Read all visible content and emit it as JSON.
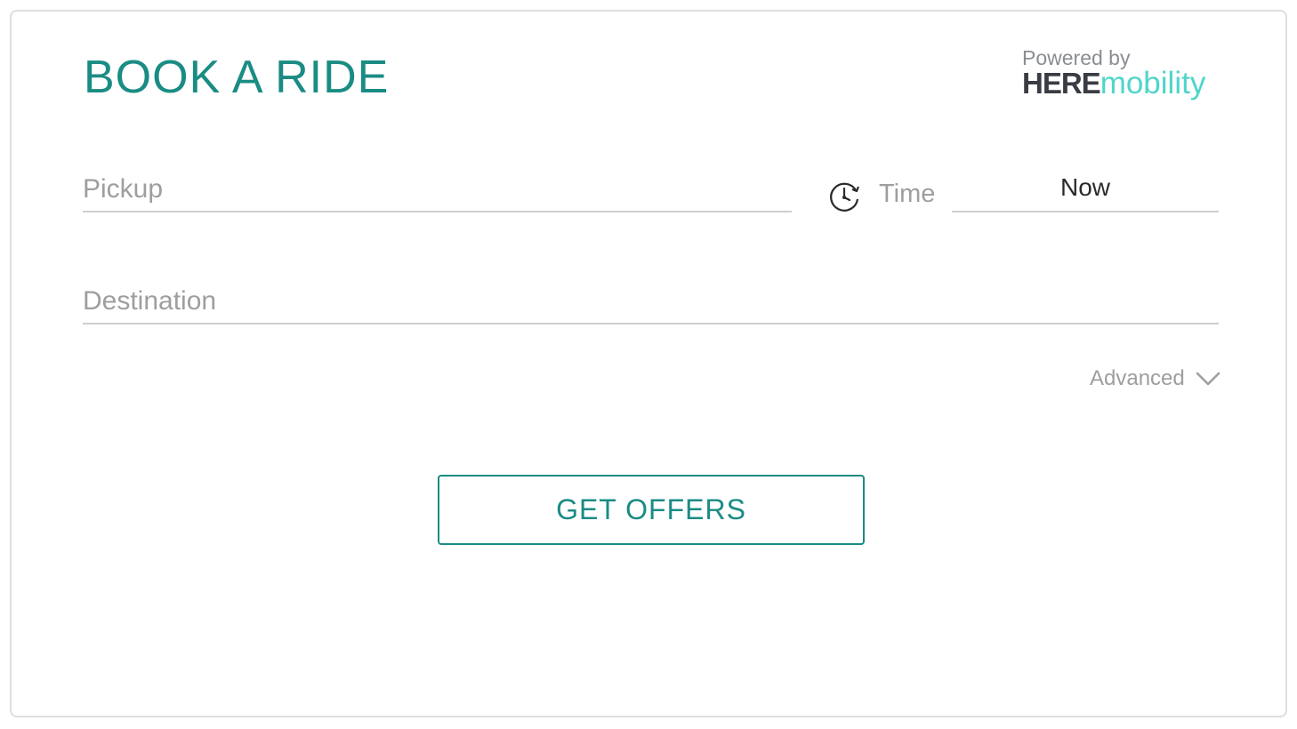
{
  "header": {
    "title": "BOOK A RIDE",
    "brand": {
      "powered_by": "Powered by",
      "logo_here": "HERE",
      "logo_mobility": "mobility"
    }
  },
  "form": {
    "pickup": {
      "placeholder": "Pickup",
      "value": ""
    },
    "time": {
      "icon": "clock-icon",
      "label": "Time",
      "value": "Now"
    },
    "destination": {
      "placeholder": "Destination",
      "value": ""
    },
    "advanced": {
      "label": "Advanced",
      "icon": "chevron-down-icon"
    },
    "submit_label": "GET OFFERS"
  },
  "colors": {
    "accent": "#1a8c84",
    "brand_dark": "#3a3c44",
    "brand_light": "#4fd5ca",
    "placeholder": "#9e9e9e",
    "underline": "#cfcfcf"
  }
}
